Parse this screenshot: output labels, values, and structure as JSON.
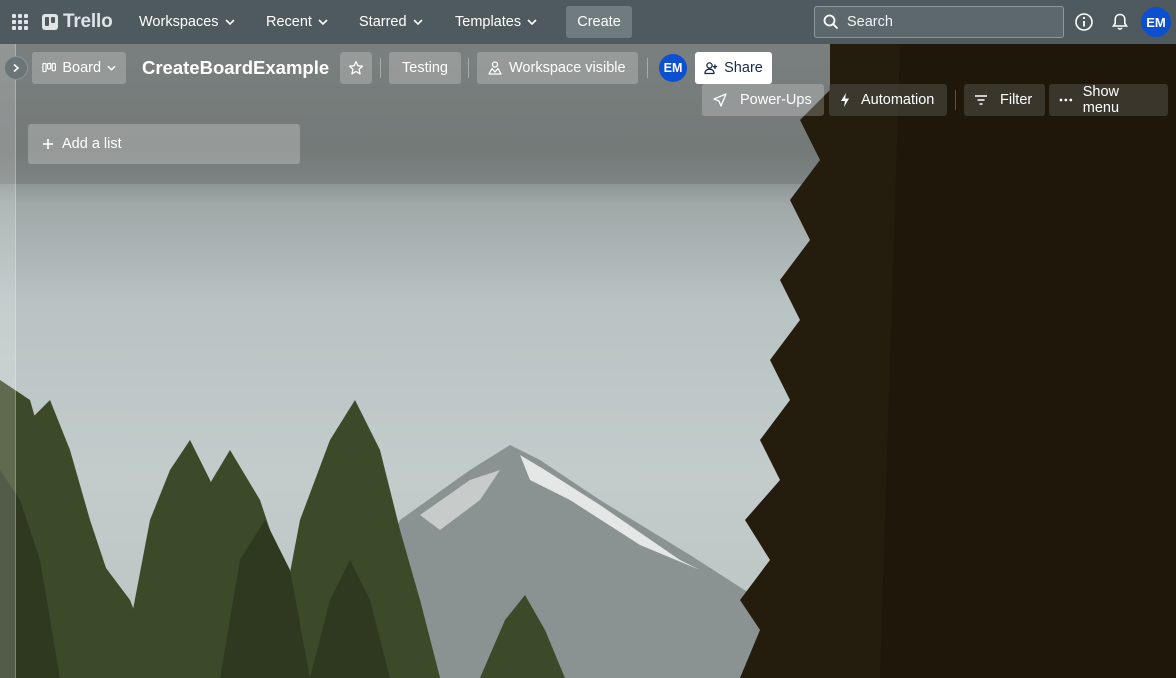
{
  "topnav": {
    "logo_text": "Trello",
    "menus": [
      {
        "label": "Workspaces"
      },
      {
        "label": "Recent"
      },
      {
        "label": "Starred"
      },
      {
        "label": "Templates"
      }
    ],
    "create_label": "Create",
    "search_placeholder": "Search",
    "avatar_initials": "EM"
  },
  "board": {
    "view_label": "Board",
    "title": "CreateBoardExample",
    "workspace_name": "Testing",
    "visibility_label": "Workspace visible",
    "member_initials": "EM",
    "share_label": "Share",
    "powerups_label": "Power-Ups",
    "automation_label": "Automation",
    "filter_label": "Filter",
    "show_menu_label": "Show menu",
    "add_list_label": "Add a list"
  },
  "colors": {
    "nav_bg": "#4e5a5e",
    "avatar_bg": "#0c4fd0",
    "share_bg": "#ffffff"
  },
  "icons": [
    "apps-grid-icon",
    "chevron-down-icon",
    "search-icon",
    "info-icon",
    "bell-icon",
    "chevron-right-icon",
    "board-icon",
    "star-icon",
    "workspace-visible-icon",
    "add-member-icon",
    "rocket-icon",
    "lightning-icon",
    "filter-icon",
    "ellipsis-icon",
    "plus-icon"
  ]
}
